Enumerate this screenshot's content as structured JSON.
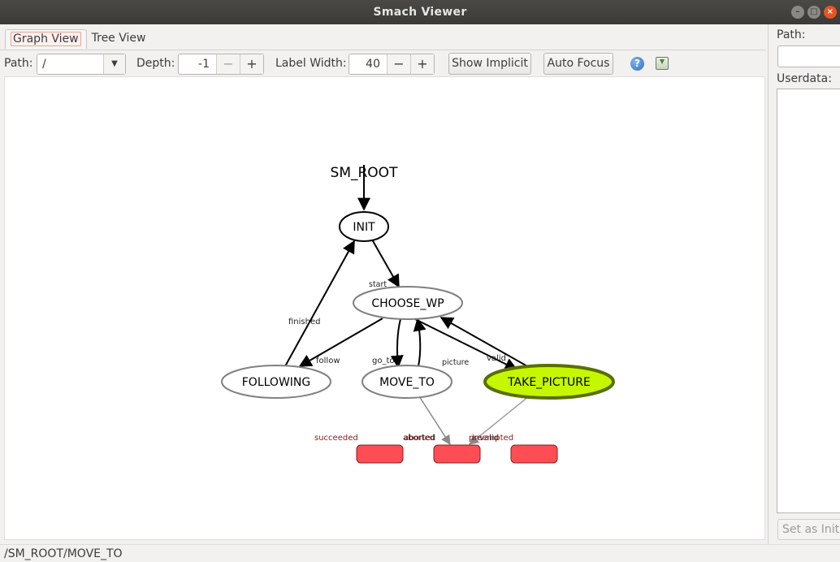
{
  "window": {
    "title": "Smach Viewer"
  },
  "tabs": [
    {
      "label": "Graph View",
      "active": true
    },
    {
      "label": "Tree View",
      "active": false
    }
  ],
  "toolbar": {
    "path_label": "Path:",
    "path_value": "/",
    "depth_label": "Depth:",
    "depth_value": "-1",
    "label_width_label": "Label Width:",
    "label_width_value": "40",
    "minus": "−",
    "plus": "+",
    "show_implicit": "Show Implicit",
    "auto_focus": "Auto Focus",
    "help_icon": "help-icon",
    "save_icon": "save-icon"
  },
  "graph": {
    "root_label": "SM_ROOT",
    "states": {
      "init": "INIT",
      "choose_wp": "CHOOSE_WP",
      "following": "FOLLOWING",
      "move_to": "MOVE_TO",
      "take_picture": "TAKE_PICTURE"
    },
    "transitions": {
      "start": "start",
      "finished": "finished",
      "follow": "follow",
      "go_to": "go_to",
      "succeeded": "succeeded",
      "picture": "picture",
      "valid": "valid",
      "aborted": "aborted",
      "invalid": "invalid"
    },
    "outcomes": {
      "succeeded": "succeeded",
      "aborted": "aborted",
      "preempted": "preempted"
    },
    "colors": {
      "active_fill": "#c6f700",
      "active_stroke": "#5a6f00",
      "outcome_fill": "#ff4d55",
      "outcome_text": "#8b1a1a",
      "inactive_stroke": "#808080"
    }
  },
  "right_panel": {
    "path_label": "Path:",
    "path_value": "",
    "userdata_label": "Userdata:",
    "set_initial_button": "Set as Initial State"
  },
  "status": {
    "path": "/SM_ROOT/MOVE_TO"
  }
}
